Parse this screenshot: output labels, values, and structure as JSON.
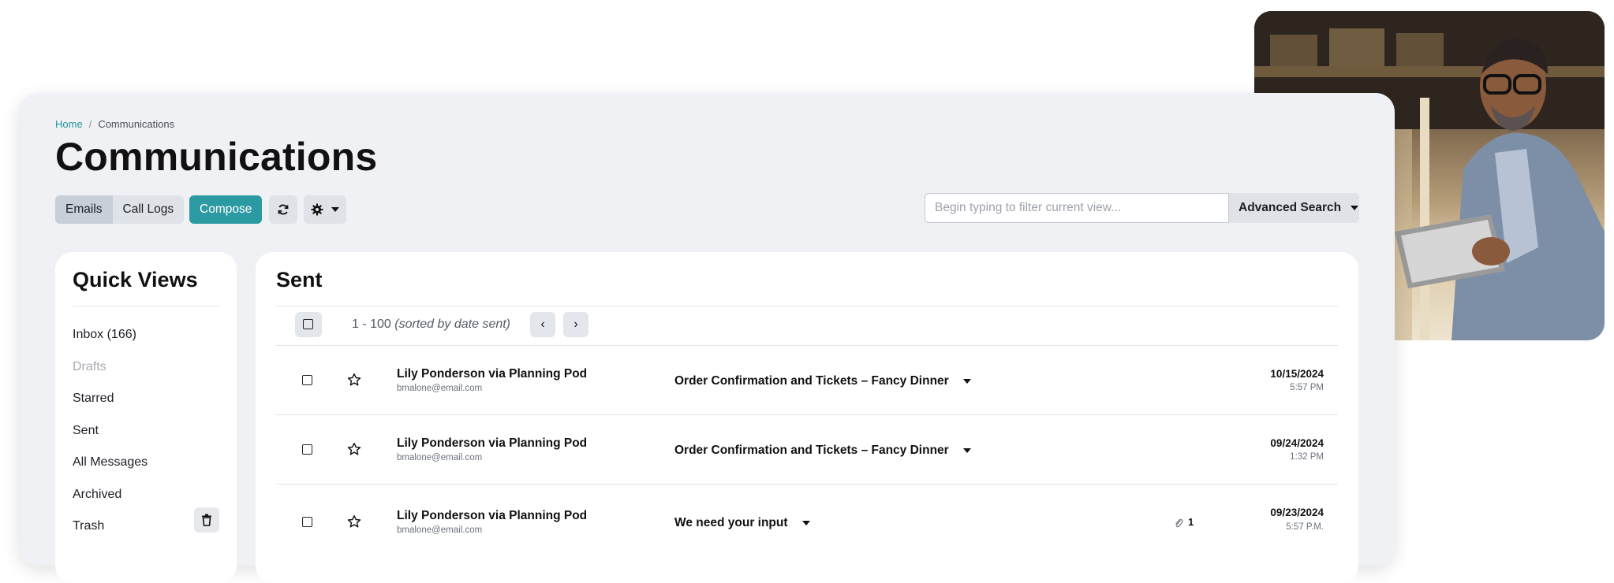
{
  "breadcrumb": {
    "home": "Home",
    "separator": "/",
    "current": "Communications"
  },
  "page": {
    "title": "Communications"
  },
  "toolbar": {
    "emails_label": "Emails",
    "call_logs_label": "Call Logs",
    "compose_label": "Compose",
    "refresh_icon": "refresh-icon",
    "settings_icon": "gear-icon",
    "accent": "#2b9aa3"
  },
  "search": {
    "placeholder": "Begin typing to filter current view...",
    "value": ""
  },
  "advanced_search": {
    "label": "Advanced Search"
  },
  "quick_views": {
    "title": "Quick Views",
    "items": [
      {
        "label": "Inbox (166)",
        "muted": false
      },
      {
        "label": "Drafts",
        "muted": true
      },
      {
        "label": "Starred",
        "muted": false
      },
      {
        "label": "Sent",
        "muted": false
      },
      {
        "label": "All Messages",
        "muted": false
      },
      {
        "label": "Archived",
        "muted": false
      },
      {
        "label": "Trash",
        "muted": false
      }
    ]
  },
  "sent": {
    "title": "Sent",
    "range": "1 - 100",
    "sort_note": "(sorted by date sent)",
    "messages": [
      {
        "sender": "Lily Ponderson via Planning Pod",
        "email": "bmalone@email.com",
        "subject": "Order Confirmation and Tickets – Fancy Dinner",
        "attachments": "",
        "date": "10/15/2024",
        "time": "5:57 PM"
      },
      {
        "sender": "Lily Ponderson via Planning Pod",
        "email": "bmalone@email.com",
        "subject": "Order Confirmation and Tickets – Fancy Dinner",
        "attachments": "",
        "date": "09/24/2024",
        "time": "1:32 PM"
      },
      {
        "sender": "Lily Ponderson via Planning Pod",
        "email": "bmalone@email.com",
        "subject": "We need your input",
        "attachments": "1",
        "date": "09/23/2024",
        "time": "5:57 P.M."
      }
    ]
  }
}
